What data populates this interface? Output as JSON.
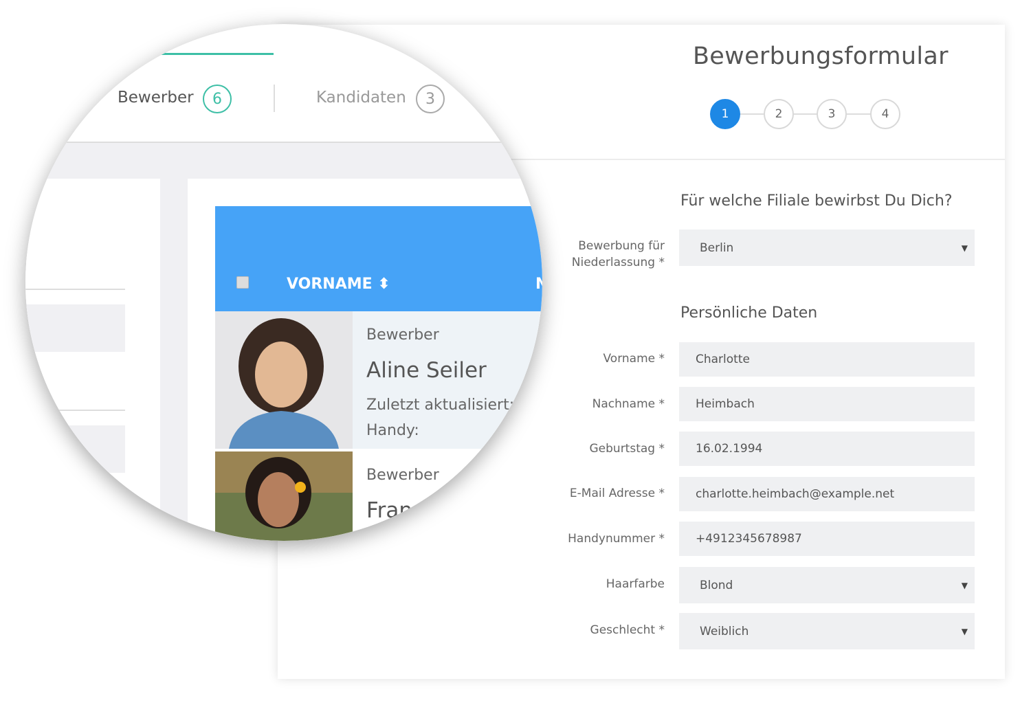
{
  "form": {
    "title": "Bewerbungsformular",
    "steps": [
      "1",
      "2",
      "3",
      "4"
    ],
    "active_step": 1,
    "section1": "Für welche Filiale bewirbst Du Dich?",
    "branch_label_1": "Bewerbung für",
    "branch_label_2": "Niederlassung *",
    "branch_value": "Berlin",
    "section2": "Persönliche Daten",
    "fields": [
      {
        "label": "Vorname *",
        "value": "Charlotte"
      },
      {
        "label": "Nachname *",
        "value": "Heimbach"
      },
      {
        "label": "Geburtstag *",
        "value": "16.02.1994"
      },
      {
        "label": "E-Mail Adresse *",
        "value": "charlotte.heimbach@example.net"
      },
      {
        "label": "Handynummer *",
        "value": "+4912345678987"
      }
    ],
    "selects": [
      {
        "label": "Haarfarbe",
        "value": "Blond"
      },
      {
        "label": "Geschlecht *",
        "value": "Weiblich"
      }
    ],
    "caret": "▼"
  },
  "magnifier": {
    "tabs": [
      {
        "label": "Bewerber",
        "count": "6"
      },
      {
        "label": "Kandidaten",
        "count": "3"
      }
    ],
    "column_header": "VORNAME",
    "sort_icon": "⬍",
    "column_header_next": "N",
    "rows": [
      {
        "status": "Bewerber",
        "name": "Aline Seiler",
        "updated": "Zuletzt aktualisiert:",
        "phone": "Handy:"
      },
      {
        "status": "Bewerber",
        "name": "Fran"
      }
    ]
  },
  "colors": {
    "accent": "#1e88e5",
    "teal": "#3dbfa6",
    "table_header": "#46a3f7"
  }
}
